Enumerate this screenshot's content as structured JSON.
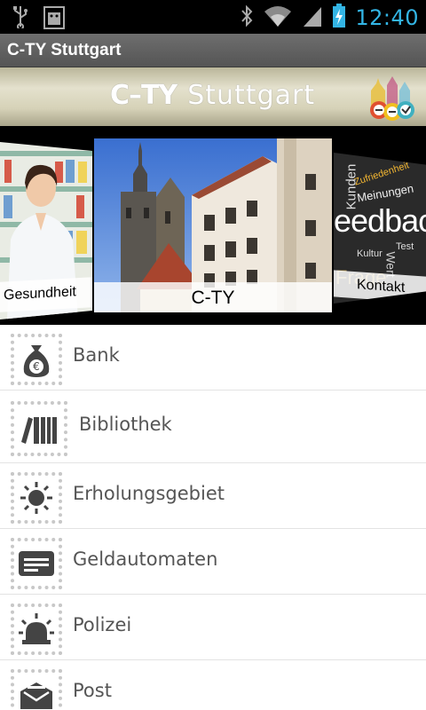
{
  "status_bar": {
    "time": "12:40",
    "left_icons": [
      "usb-icon",
      "android-debug-icon"
    ],
    "right_icons": [
      "bluetooth-icon",
      "wifi-icon",
      "signal-icon",
      "battery-charging-icon"
    ],
    "accent_color": "#33b5e5"
  },
  "app_bar": {
    "title": "C-TY Stuttgart"
  },
  "banner": {
    "brand_mark": "C–TY",
    "brand_city": "Stuttgart"
  },
  "carousel": {
    "left_label": "Gesundheit",
    "center_label": "C-TY",
    "right_label": "Kontakt",
    "right_words": [
      "Kunden",
      "Zufriedenheit",
      "Meinungen",
      "eedbac",
      "Kultur",
      "Test",
      "Frage",
      "Wert"
    ]
  },
  "categories": [
    {
      "label": "Bank",
      "icon": "money-bag-icon"
    },
    {
      "label": "Bibliothek",
      "icon": "books-icon"
    },
    {
      "label": "Erholungsgebiet",
      "icon": "sun-icon"
    },
    {
      "label": "Geldautomaten",
      "icon": "atm-card-icon"
    },
    {
      "label": "Polizei",
      "icon": "police-siren-icon"
    },
    {
      "label": "Post",
      "icon": "mail-envelope-icon"
    }
  ]
}
